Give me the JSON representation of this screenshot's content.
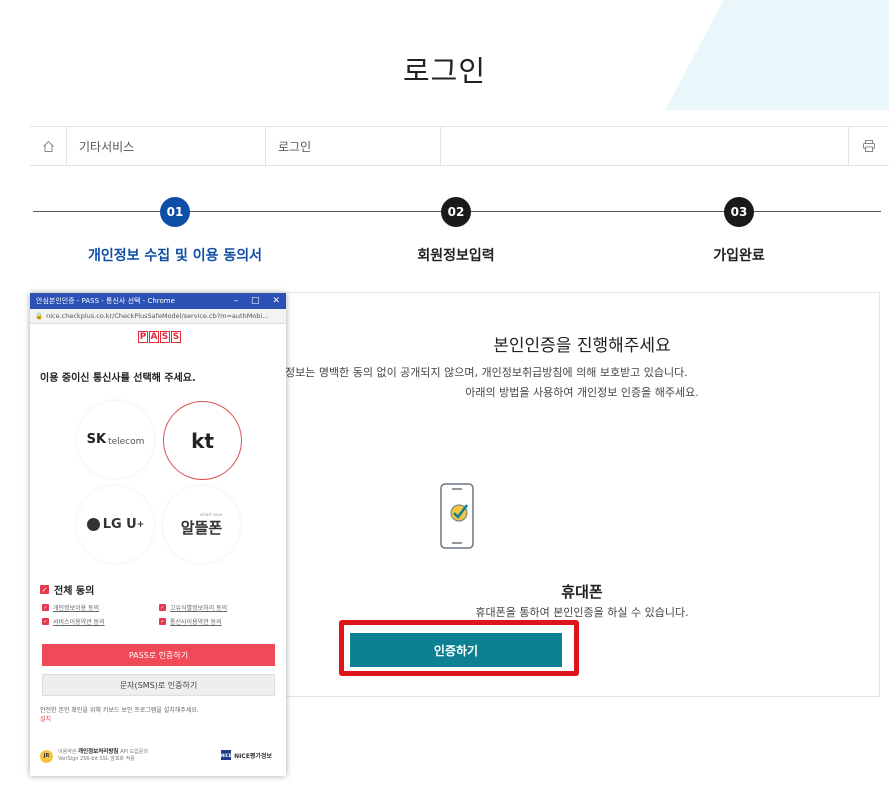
{
  "page": {
    "title": "로그인"
  },
  "breadcrumb": {
    "item1": "기타서비스",
    "item2": "로그인"
  },
  "steps": [
    {
      "num": "01",
      "label": "개인정보 수집 및 이용 동의서",
      "color": "#0d4ea6"
    },
    {
      "num": "02",
      "label": "회원정보입력",
      "color": "#1a1a1a"
    },
    {
      "num": "03",
      "label": "가입완료",
      "color": "#1a1a1a"
    }
  ],
  "panel": {
    "heading": "본인인증을 진행해주세요",
    "desc1": "정보는 명백한 동의 없이 공개되지 않으며, 개인정보취급방침에 의해 보호받고 있습니다.",
    "desc2": "아래의 방법을 사용하여 개인정보 인증을 해주세요.",
    "phone_label": "휴대폰",
    "phone_desc": "휴대폰을 통하여 본인인증을 하실 수 있습니다.",
    "verify_button": "인증하기",
    "accent": "#0d8191",
    "highlight": "#e0151b"
  },
  "popup": {
    "window_title": "안심본인인증 - PASS - 통신사 선택 - Chrome",
    "url": "nice.checkplus.co.kr/CheckPlusSafeModel/service.cb?m=authMobi...",
    "logo_letters": [
      "P",
      "A",
      "S",
      "S"
    ],
    "heading": "이용 중이신 통신사를 선택해 주세요.",
    "carriers": {
      "skt_main": "SK",
      "skt_sub": "telecom",
      "kt": "kt",
      "lgu": "LG U",
      "lgu_plus": "+",
      "mvno_small": "smart save",
      "mvno": "알뜰폰"
    },
    "agree_all": "전체 동의",
    "terms": [
      "개인정보이용 동의",
      "고유식별정보처리 동의",
      "서비스이용약관 동의",
      "통신사이용약관 동의"
    ],
    "pass_button": "PASS로 인증하기",
    "sms_button": "문자(SMS)로 인증하기",
    "note": "안전한 본인 확인을 위해 키보드 보안 프로그램을 설치해주세요.",
    "install": "설치",
    "footer_seal": "JR",
    "footer_line1_prefix": "이용약관",
    "footer_line1_bold": "개인정보처리방침",
    "footer_line1_suffix": "API 도입문의",
    "footer_line2": "VeriSign 256-bit SSL 암호화 적용",
    "nice_label": "NICE평가정보",
    "pass_color": "#f04a58"
  }
}
